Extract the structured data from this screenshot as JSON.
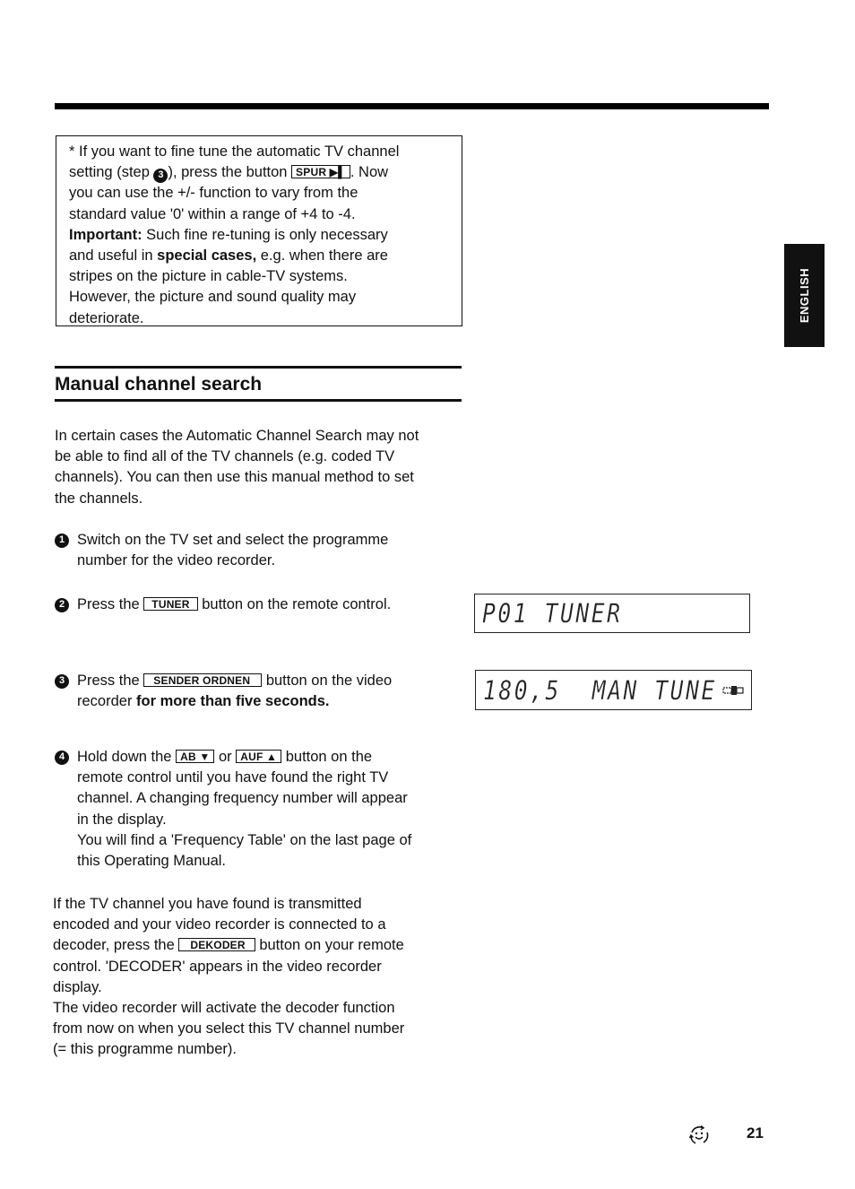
{
  "note": {
    "line1": "* If you want to fine tune the automatic TV channel",
    "line2_a": "setting (step ",
    "line2_step": "3",
    "line2_b": "), press the button ",
    "line2_button": "SPUR ▶▌",
    "line2_c": ". Now",
    "line3": "you can use the +/- function to vary from the",
    "line4": "standard value '0' within a range of +4 to -4.",
    "line5_bold": "Important:",
    "line5_rest": " Such fine re-tuning is only necessary",
    "line6_a": "and useful in ",
    "line6_bold": "special cases,",
    "line6_b": " e.g. when there are",
    "line7": "stripes on the picture in cable-TV systems.",
    "line8": "However, the picture and sound quality may",
    "line9": "deteriorate."
  },
  "section": {
    "title": "Manual channel search",
    "intro": [
      "In certain cases the Automatic Channel Search may not",
      "be able to find all of the TV channels (e.g. coded TV",
      "channels). You can then use this manual method to set",
      "the channels."
    ]
  },
  "steps": [
    {
      "number": "1",
      "lines": [
        "Switch on the TV set and select the programme",
        "number for the video recorder."
      ]
    },
    {
      "number": "2",
      "pre": "Press the ",
      "button": "TUNER",
      "post": " button on the remote control."
    },
    {
      "number": "3",
      "pre": "Press the ",
      "button": "SENDER ORDNEN",
      "post": " button on the video",
      "line2_a": "recorder ",
      "line2_bold": "for more than five seconds."
    },
    {
      "number": "4",
      "pre": "Hold down the ",
      "button1": "AB ▼",
      "mid": " or ",
      "button2": "AUF ▲",
      "post": " button on the",
      "lines": [
        "remote control until you have found the right TV",
        "channel. A changing frequency number will appear",
        "in the display.",
        "You will find a 'Frequency Table' on the last page of",
        "this Operating Manual."
      ]
    }
  ],
  "decoder_para": {
    "line1": "If the TV channel you have found is transmitted",
    "line2": "encoded and your video recorder is connected to a",
    "line3_a": "decoder, press the ",
    "line3_button": "DEKODER",
    "line3_b": " button on your remote",
    "line4": "control. 'DECODER' appears in the video recorder",
    "line5": "display.",
    "line6": "The video recorder will activate the decoder function",
    "line7": "from now on when you select this TV channel number",
    "line8": "(= this programme number)."
  },
  "displays": [
    {
      "text": "P01 TUNER"
    },
    {
      "text": "180,5  MAN TUNE",
      "icon": "decoder-indicator-icon"
    }
  ],
  "language_tab": "ENGLISH",
  "page_number": "21",
  "footer_icon": "recycle-smiley-icon"
}
